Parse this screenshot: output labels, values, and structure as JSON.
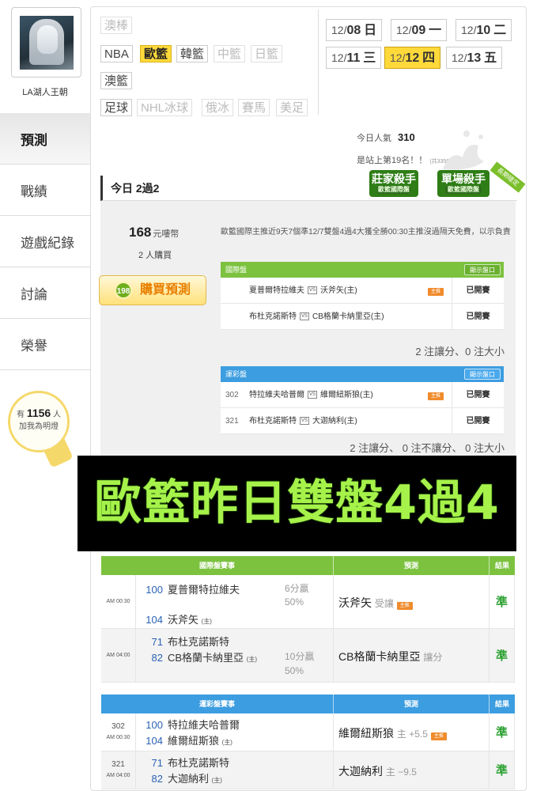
{
  "user": {
    "name": "LA湖人王朝"
  },
  "nav": [
    {
      "label": "預測",
      "active": true
    },
    {
      "label": "戰績"
    },
    {
      "label": "遊戲紀錄"
    },
    {
      "label": "討論"
    },
    {
      "label": "榮譽"
    }
  ],
  "fans": {
    "prefix": "有",
    "count": "1156",
    "suffix": "人",
    "sub": "加我為明燈"
  },
  "sports": {
    "row0": [
      "澳棒"
    ],
    "row1": [
      "NBA",
      "歐籃",
      "韓籃",
      "中籃",
      "日籃"
    ],
    "row2": [
      "澳籃"
    ],
    "row3": [
      "足球",
      "NHL冰球",
      "俄冰",
      "賽馬",
      "美足"
    ],
    "active": "歐籃",
    "disabled": [
      "澳棒",
      "中籃",
      "日籃",
      "NHL冰球",
      "俄冰",
      "賽馬",
      "美足"
    ]
  },
  "dates": [
    {
      "md": "12/",
      "d": "08",
      "w": "日"
    },
    {
      "md": "12/",
      "d": "09",
      "w": "一"
    },
    {
      "md": "12/",
      "d": "10",
      "w": "二"
    },
    {
      "md": "12/",
      "d": "11",
      "w": "三"
    },
    {
      "md": "12/",
      "d": "12",
      "w": "四",
      "active": true
    },
    {
      "md": "12/",
      "d": "13",
      "w": "五"
    }
  ],
  "popularity": {
    "label": "今日人氣",
    "value": "310"
  },
  "rank": {
    "text": "是站上第19名！！",
    "small": "(共3350人)"
  },
  "badges": {
    "b1": "莊家殺手",
    "b1_sub": "歐籃國際盤",
    "b2": "單場殺手",
    "b2_sub": "歐籃國際盤",
    "ribbon": "長期穩定"
  },
  "today": {
    "label": "今日 2過2"
  },
  "card": {
    "price": "168",
    "price_unit": "元嘍幣",
    "buyers": "2 人購買",
    "buy_label": "購買預測",
    "coin": "198",
    "desc": "歐籃國際主推近9天7個準12/7雙盤4過4大獲全勝00:30主推沒過隔天免費，以示負責"
  },
  "intl": {
    "title": "國際盤",
    "show": "顯示盤口",
    "tag": "主推",
    "rows": [
      {
        "away": "夏普爾特拉維夫",
        "home": "沃斧矢(主)",
        "tag": true,
        "status": "已開賽"
      },
      {
        "away": "布杜克諾斯特",
        "home": "CB格蘭卡納里亞(主)",
        "tag": false,
        "status": "已開賽"
      }
    ],
    "summary": "2 注讓分、0 注大小"
  },
  "lottery": {
    "title": "運彩盤",
    "show": "顯示盤口",
    "tag": "主推",
    "rows": [
      {
        "num": "302",
        "away": "特拉維夫哈普爾",
        "home": "維爾紐斯狼(主)",
        "tag": true,
        "status": "已開賽"
      },
      {
        "num": "321",
        "away": "布杜克諾斯特",
        "home": "大迦納利(主)",
        "tag": false,
        "status": "已開賽"
      }
    ],
    "summary": "2 注讓分、 0 注不讓分、 0 注大小"
  },
  "banner": "歐籃昨日雙盤4過4",
  "intl_table": {
    "headers": [
      "國際盤賽事",
      "預測",
      "結果"
    ],
    "rows": [
      {
        "time": "AM 00:30",
        "n1": "100",
        "t1": "夏普爾特拉維夫",
        "n2": "104",
        "t2": "沃斧矢",
        "h2": "(主)",
        "line": "6分贏",
        "pct": "50%",
        "pick": "沃斧矢",
        "pick_note": "受讓",
        "tag": "主推",
        "result": "準"
      },
      {
        "time": "AM 04:00",
        "n1": "71",
        "t1": "布杜克諾斯特",
        "n2": "82",
        "t2": "CB格蘭卡納里亞",
        "h2": "(主)",
        "line": "10分贏",
        "pct": "50%",
        "pick": "CB格蘭卡納里亞",
        "pick_note": "讓分",
        "tag": "",
        "result": "準"
      }
    ]
  },
  "lottery_table": {
    "headers": [
      "運彩盤賽事",
      "預測",
      "結果"
    ],
    "rows": [
      {
        "num": "302",
        "time": "AM 00:30",
        "n1": "100",
        "t1": "特拉維夫哈普爾",
        "n2": "104",
        "t2": "維爾紐斯狼",
        "h2": "(主)",
        "pick": "維爾紐斯狼",
        "pick_note": "主 +5.5",
        "tag": "主推",
        "result": "準"
      },
      {
        "num": "321",
        "time": "AM 04:00",
        "n1": "71",
        "t1": "布杜克諾斯特",
        "n2": "82",
        "t2": "大迦納利",
        "h2": "(主)",
        "pick": "大迦納利",
        "pick_note": "主 −9.5",
        "tag": "",
        "result": "準"
      }
    ]
  },
  "colors": {
    "green_head": "#7cc23f",
    "blue_head": "#3c9de0",
    "active_yellow": "#ffd93a",
    "banner_green": "#a6f24a",
    "result_green": "#2fa234"
  }
}
